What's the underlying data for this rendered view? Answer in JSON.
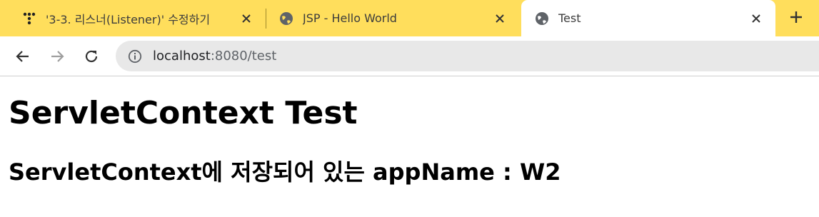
{
  "browser": {
    "tabs": [
      {
        "title": "'3-3. 리스너(Listener)' 수정하기",
        "icon": "tistory-logo-icon",
        "active": false
      },
      {
        "title": "JSP - Hello World",
        "icon": "globe-icon",
        "active": false
      },
      {
        "title": "Test",
        "icon": "globe-icon",
        "active": true
      }
    ],
    "new_tab_icon": "plus-icon",
    "address_bar": {
      "host": "localhost",
      "path": ":8080/test"
    },
    "colors": {
      "tabstrip": "#ffde5c",
      "active_tab": "#ffffff",
      "omnibox": "#e8e8e8"
    }
  },
  "page": {
    "heading": "ServletContext Test",
    "subheading": "ServletContext에 저장되어 있는 appName : W2"
  }
}
